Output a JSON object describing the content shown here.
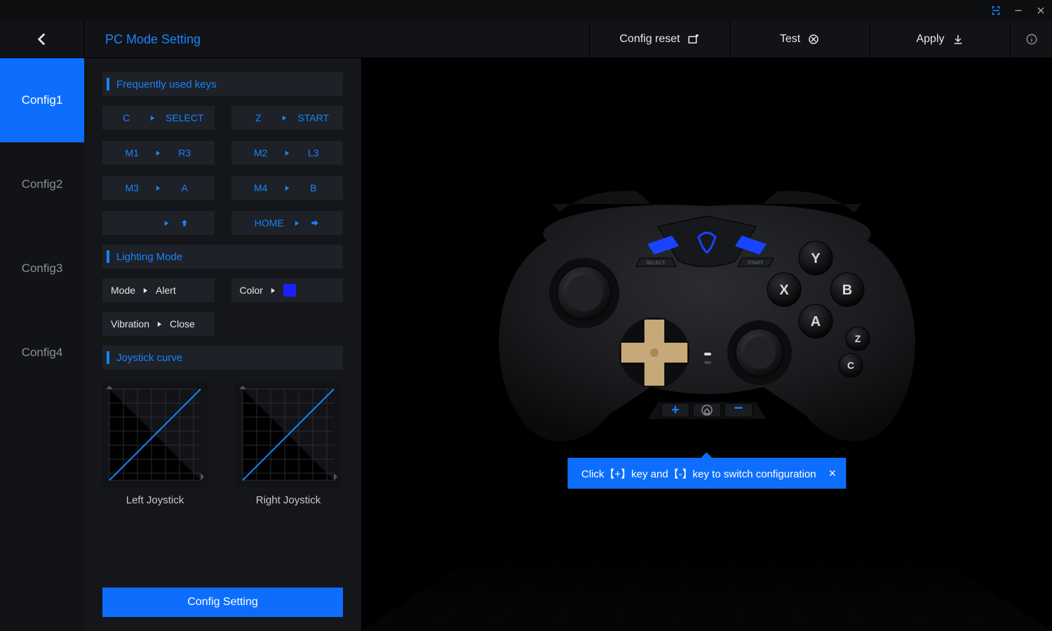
{
  "titlebar": {
    "window_control_min": "−",
    "window_control_close": "×"
  },
  "topbar": {
    "title": "PC Mode Setting",
    "config_reset": "Config reset",
    "test": "Test",
    "apply": "Apply"
  },
  "tabs": [
    "Config1",
    "Config2",
    "Config3",
    "Config4"
  ],
  "active_tab_index": 0,
  "sections": {
    "frequent": "Frequently used keys",
    "lighting": "Lighting Mode",
    "curve": "Joystick curve"
  },
  "key_mappings": [
    {
      "from": "C",
      "to": "SELECT"
    },
    {
      "from": "Z",
      "to": "START"
    },
    {
      "from": "M1",
      "to": "R3"
    },
    {
      "from": "M2",
      "to": "L3"
    },
    {
      "from": "M3",
      "to": "A"
    },
    {
      "from": "M4",
      "to": "B"
    },
    {
      "from_icon": "",
      "to_icon": "arrow-up"
    },
    {
      "from": "HOME",
      "to_icon": "arrow-right"
    }
  ],
  "lighting": {
    "mode_label": "Mode",
    "mode_value": "Alert",
    "color_label": "Color",
    "color_value": "#1a20ff",
    "vibration_label": "Vibration",
    "vibration_value": "Close"
  },
  "curves": {
    "left_label": "Left Joystick",
    "right_label": "Right Joystick"
  },
  "config_setting_button": "Config Setting",
  "tooltip_text": "Click【+】key and【-】key to switch configuration",
  "chart_data": [
    {
      "type": "line",
      "title": "Left Joystick",
      "xlabel": "",
      "ylabel": "",
      "xlim": [
        0,
        1
      ],
      "ylim": [
        0,
        1
      ],
      "x": [
        0,
        1
      ],
      "y": [
        0,
        1
      ]
    },
    {
      "type": "line",
      "title": "Right Joystick",
      "xlabel": "",
      "ylabel": "",
      "xlim": [
        0,
        1
      ],
      "ylim": [
        0,
        1
      ],
      "x": [
        0,
        1
      ],
      "y": [
        0,
        1
      ]
    }
  ]
}
